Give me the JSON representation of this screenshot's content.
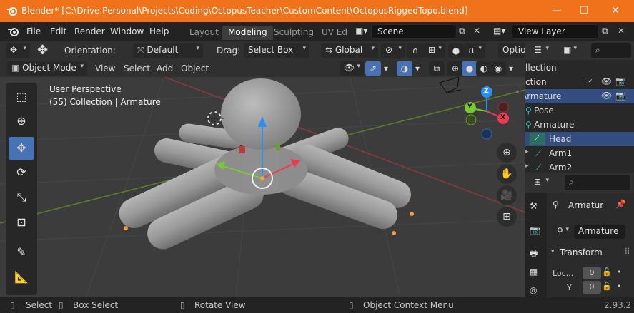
{
  "window": {
    "title": "Blender* [C:\\Drive.Personal\\Projects\\Coding\\OctopusTeacher\\CustomContent\\OctopusRiggedTopo.blend]",
    "minimize": "—",
    "maximize": "☐",
    "close": "✕"
  },
  "menu": [
    "File",
    "Edit",
    "Render",
    "Window",
    "Help"
  ],
  "workspace_tabs": [
    "Layout",
    "Modeling",
    "Sculpting",
    "UV Ed"
  ],
  "active_tab": "Modeling",
  "scene": "Scene",
  "view_layer": "View Layer",
  "header": {
    "orientation_label": "Orientation:",
    "orientation_value": "Default",
    "drag_label": "Drag:",
    "drag_value": "Select Box",
    "transform_orientation": "Global",
    "options": "Optio"
  },
  "header2": {
    "mode": "Object Mode",
    "view": "View",
    "select": "Select",
    "add": "Add",
    "object": "Object"
  },
  "viewport": {
    "perspective": "User Perspective",
    "context": "(55) Collection | Armature",
    "gizmo_x": "X",
    "gizmo_y": "Y",
    "gizmo_z": "Z"
  },
  "outliner": {
    "rows": [
      {
        "label": "llection",
        "indent": 0
      },
      {
        "label": "ction",
        "indent": 0
      },
      {
        "label": "Armature",
        "indent": 0
      },
      {
        "label": "Pose",
        "indent": 1
      },
      {
        "label": "Armature",
        "indent": 1
      },
      {
        "label": "Head",
        "indent": 2
      },
      {
        "label": "Arm1",
        "indent": 2
      },
      {
        "label": "Arm2",
        "indent": 2
      }
    ]
  },
  "properties": {
    "object_name": "Armatur",
    "data_name": "Armature",
    "section": "Transform",
    "loc_label": "Loc...",
    "loc_x": "0",
    "y_label": "Y",
    "loc_y": "0"
  },
  "status": {
    "select": "Select",
    "box_select": "Box Select",
    "rotate_view": "Rotate View",
    "context_menu": "Object Context Menu",
    "version": "2.93.2"
  },
  "colors": {
    "titlebar": "#f0721b",
    "active_tool": "#4772b3",
    "x_axis": "#f03a52",
    "y_axis": "#79c930",
    "z_axis": "#2c8ef0",
    "selection": "#334d80"
  }
}
